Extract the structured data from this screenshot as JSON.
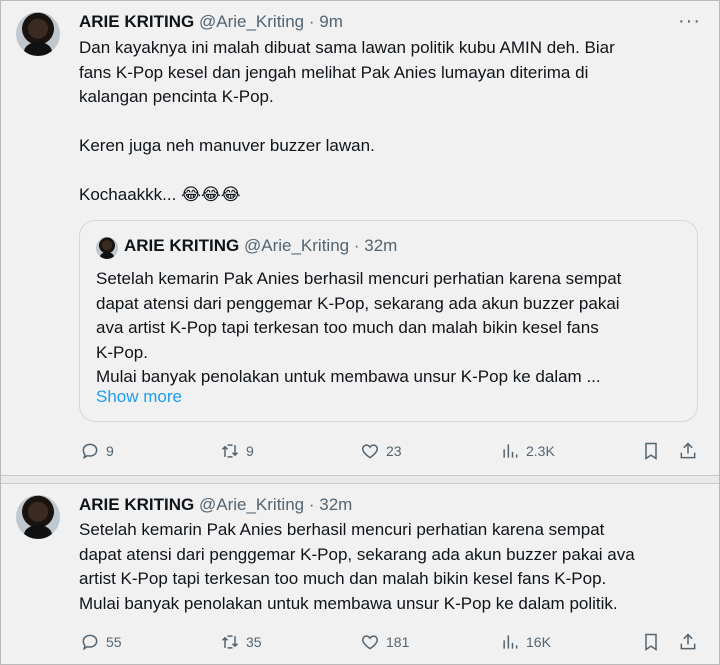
{
  "tweets": [
    {
      "author": "ARIE KRITING",
      "handle": "@Arie_Kriting",
      "dot": "·",
      "time": "9m",
      "text_lines": [
        "Dan kayaknya ini malah dibuat sama lawan politik kubu AMIN deh. Biar",
        "fans K-Pop kesel dan jengah melihat Pak Anies lumayan diterima di",
        "kalangan pencinta K-Pop."
      ],
      "text_para2": "Keren juga neh manuver buzzer lawan.",
      "text_para3": "Kochaakkk... 😂😂😂",
      "quote": {
        "author": "ARIE KRITING",
        "handle": "@Arie_Kriting",
        "dot": "·",
        "time": "32m",
        "lines": [
          "Setelah kemarin Pak Anies berhasil mencuri perhatian karena sempat",
          "dapat atensi dari penggemar K-Pop, sekarang ada akun buzzer pakai",
          "ava artist K-Pop tapi terkesan too much dan malah bikin kesel fans",
          "K-Pop.",
          "Mulai banyak penolakan untuk membawa unsur K-Pop ke dalam ..."
        ],
        "show_more": "Show more"
      },
      "stats": {
        "replies": "9",
        "retweets": "9",
        "likes": "23",
        "views": "2.3K"
      }
    },
    {
      "author": "ARIE KRITING",
      "handle": "@Arie_Kriting",
      "dot": "·",
      "time": "32m",
      "text_lines": [
        "Setelah kemarin Pak Anies berhasil mencuri perhatian karena sempat",
        "dapat atensi dari penggemar K-Pop, sekarang ada akun buzzer pakai ava",
        "artist K-Pop tapi terkesan too much dan malah bikin kesel fans K-Pop.",
        "Mulai banyak penolakan untuk membawa unsur K-Pop ke dalam politik."
      ],
      "stats": {
        "replies": "55",
        "retweets": "35",
        "likes": "181",
        "views": "16K"
      }
    }
  ],
  "icons": {
    "more": "more-horizontal-icon",
    "reply": "reply-icon",
    "retweet": "retweet-icon",
    "like": "heart-icon",
    "views": "views-icon",
    "bookmark": "bookmark-icon",
    "share": "share-icon"
  },
  "colors": {
    "link": "#1d9bf0",
    "muted": "#536471",
    "text": "#0f1419"
  }
}
